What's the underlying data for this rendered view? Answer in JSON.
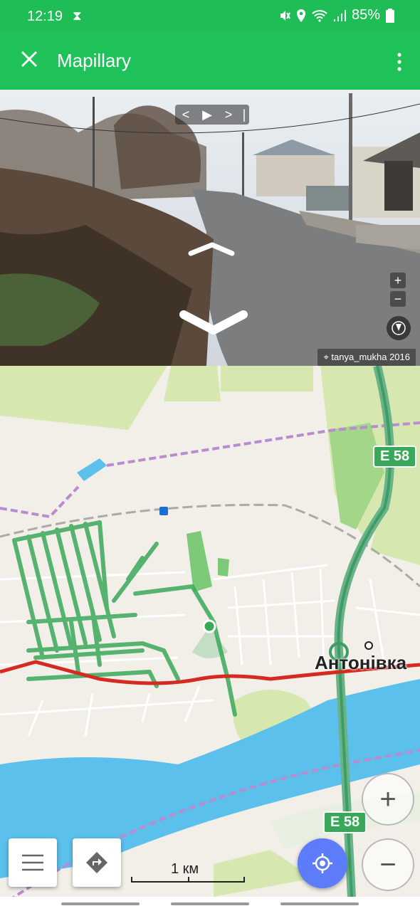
{
  "status_bar": {
    "time": "12:19",
    "battery": "85%",
    "icons": [
      "hourglass-icon",
      "mute-icon",
      "location-icon",
      "wifi-icon",
      "signal-icon",
      "battery-icon"
    ]
  },
  "app_bar": {
    "title": "Mapillary",
    "close_icon": "close-icon",
    "menu_icon": "more-vert-icon",
    "color": "#1fc259"
  },
  "photo_viewer": {
    "credit": "tanya_mukha 2016",
    "player_controls": [
      "<",
      "▶",
      ">",
      "|"
    ],
    "zoom_in": "+",
    "zoom_out": "−"
  },
  "map": {
    "place_label": "Антонівка",
    "route_badges": [
      "E 58",
      "E 58"
    ],
    "scale_label": "1 км",
    "colors": {
      "land": "#f2efe9",
      "water": "#5bc0eb",
      "green": "#c8e6a0",
      "road_red": "#d42a1f",
      "mapillary_green": "#3aa85a",
      "locate_button": "#5c7cfa"
    }
  },
  "controls": {
    "zoom_in": "+",
    "zoom_out": "−",
    "menu_icon": "hamburger-icon",
    "directions_icon": "directions-icon",
    "locate_icon": "my-location-icon"
  }
}
